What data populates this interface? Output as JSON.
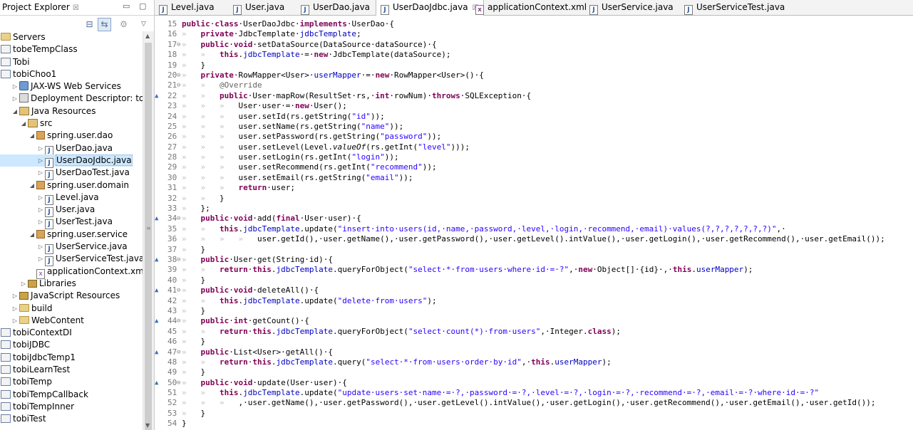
{
  "explorer": {
    "title": "Project Explorer",
    "items": [
      {
        "indent": 0,
        "arrow": "",
        "icon": "folder",
        "label": "Servers"
      },
      {
        "indent": 0,
        "arrow": "",
        "icon": "project",
        "label": "tobeTempClass"
      },
      {
        "indent": 0,
        "arrow": "",
        "icon": "project",
        "label": "Tobi"
      },
      {
        "indent": 0,
        "arrow": "",
        "icon": "project",
        "label": "tobiChoo1"
      },
      {
        "indent": 1,
        "arrow": "▷",
        "icon": "ws",
        "label": "JAX-WS Web Services"
      },
      {
        "indent": 1,
        "arrow": "▷",
        "icon": "dd",
        "label": "Deployment Descriptor: tobiCh"
      },
      {
        "indent": 1,
        "arrow": "◢",
        "icon": "res",
        "label": "Java Resources"
      },
      {
        "indent": 2,
        "arrow": "◢",
        "icon": "res",
        "label": "src"
      },
      {
        "indent": 3,
        "arrow": "◢",
        "icon": "package",
        "label": "spring.user.dao"
      },
      {
        "indent": 4,
        "arrow": "▷",
        "icon": "java",
        "label": "UserDao.java"
      },
      {
        "indent": 4,
        "arrow": "▷",
        "icon": "java",
        "label": "UserDaoJdbc.java",
        "selected": true
      },
      {
        "indent": 4,
        "arrow": "▷",
        "icon": "java",
        "label": "UserDaoTest.java"
      },
      {
        "indent": 3,
        "arrow": "◢",
        "icon": "package",
        "label": "spring.user.domain"
      },
      {
        "indent": 4,
        "arrow": "▷",
        "icon": "java",
        "label": "Level.java"
      },
      {
        "indent": 4,
        "arrow": "▷",
        "icon": "java",
        "label": "User.java"
      },
      {
        "indent": 4,
        "arrow": "▷",
        "icon": "java",
        "label": "UserTest.java"
      },
      {
        "indent": 3,
        "arrow": "◢",
        "icon": "package",
        "label": "spring.user.service"
      },
      {
        "indent": 4,
        "arrow": "▷",
        "icon": "java",
        "label": "UserService.java"
      },
      {
        "indent": 4,
        "arrow": "▷",
        "icon": "java",
        "label": "UserServiceTest.java"
      },
      {
        "indent": 3,
        "arrow": "",
        "icon": "xml",
        "label": "applicationContext.xml"
      },
      {
        "indent": 2,
        "arrow": "▷",
        "icon": "lib",
        "label": "Libraries"
      },
      {
        "indent": 1,
        "arrow": "▷",
        "icon": "lib",
        "label": "JavaScript Resources"
      },
      {
        "indent": 1,
        "arrow": "▷",
        "icon": "folder",
        "label": "build"
      },
      {
        "indent": 1,
        "arrow": "▷",
        "icon": "folder",
        "label": "WebContent"
      },
      {
        "indent": 0,
        "arrow": "",
        "icon": "project",
        "label": "tobiContextDI"
      },
      {
        "indent": 0,
        "arrow": "",
        "icon": "project",
        "label": "tobiJDBC"
      },
      {
        "indent": 0,
        "arrow": "",
        "icon": "project",
        "label": "tobiJdbcTemp1"
      },
      {
        "indent": 0,
        "arrow": "",
        "icon": "project",
        "label": "tobiLearnTest"
      },
      {
        "indent": 0,
        "arrow": "",
        "icon": "project",
        "label": "tobiTemp"
      },
      {
        "indent": 0,
        "arrow": "",
        "icon": "project",
        "label": "tobiTempCallback"
      },
      {
        "indent": 0,
        "arrow": "",
        "icon": "project",
        "label": "tobiTempInner"
      },
      {
        "indent": 0,
        "arrow": "",
        "icon": "project",
        "label": "tobiTest"
      }
    ]
  },
  "tabs": [
    {
      "label": "Level.java",
      "icon": "java"
    },
    {
      "label": "User.java",
      "icon": "java"
    },
    {
      "label": "UserDao.java",
      "icon": "java"
    },
    {
      "label": "UserDaoJdbc.java",
      "icon": "java",
      "active": true
    },
    {
      "label": "applicationContext.xml",
      "icon": "xml"
    },
    {
      "label": "UserService.java",
      "icon": "java"
    },
    {
      "label": "UserServiceTest.java",
      "icon": "java"
    }
  ],
  "code": [
    {
      "n": "15",
      "segs": [
        [
          "k",
          "public"
        ],
        [
          "",
          "·"
        ],
        [
          "k",
          "class"
        ],
        [
          "",
          "·UserDaoJdbc·"
        ],
        [
          "k",
          "implements"
        ],
        [
          "",
          "·UserDao·{"
        ]
      ]
    },
    {
      "n": "16",
      "segs": [
        [
          "ws",
          "»   "
        ],
        [
          "k",
          "private"
        ],
        [
          "",
          "·JdbcTemplate·"
        ],
        [
          "f",
          "jdbcTemplate"
        ],
        [
          "",
          ";"
        ]
      ]
    },
    {
      "n": "17",
      "mark": "⊖",
      "segs": [
        [
          "ws",
          "»   "
        ],
        [
          "k",
          "public"
        ],
        [
          "",
          "·"
        ],
        [
          "k",
          "void"
        ],
        [
          "",
          "·setDataSource(DataSource·dataSource)·{"
        ]
      ]
    },
    {
      "n": "18",
      "segs": [
        [
          "ws",
          "»   »   "
        ],
        [
          "k",
          "this"
        ],
        [
          "",
          "."
        ],
        [
          "f",
          "jdbcTemplate"
        ],
        [
          "",
          "·=·"
        ],
        [
          "k",
          "new"
        ],
        [
          "",
          "·JdbcTemplate(dataSource);"
        ]
      ]
    },
    {
      "n": "19",
      "segs": [
        [
          "ws",
          "»   "
        ],
        [
          "",
          "}"
        ]
      ]
    },
    {
      "n": "20",
      "mark": "⊖",
      "segs": [
        [
          "ws",
          "»   "
        ],
        [
          "k",
          "private"
        ],
        [
          "",
          "·RowMapper<User>·"
        ],
        [
          "f",
          "userMapper"
        ],
        [
          "",
          "·=·"
        ],
        [
          "k",
          "new"
        ],
        [
          "",
          "·RowMapper<User>()·{"
        ]
      ]
    },
    {
      "n": "21",
      "mark": "⊖",
      "segs": [
        [
          "ws",
          "»   »   "
        ],
        [
          "a",
          "@Override"
        ]
      ]
    },
    {
      "n": "22",
      "ovr": true,
      "segs": [
        [
          "ws",
          "»   »   "
        ],
        [
          "k",
          "public"
        ],
        [
          "",
          "·User·mapRow(ResultSet·rs,·"
        ],
        [
          "k",
          "int"
        ],
        [
          "",
          "·rowNum)·"
        ],
        [
          "k",
          "throws"
        ],
        [
          "",
          "·SQLException·{"
        ]
      ]
    },
    {
      "n": "23",
      "segs": [
        [
          "ws",
          "»   »   »   "
        ],
        [
          "",
          "User·user·=·"
        ],
        [
          "k",
          "new"
        ],
        [
          "",
          "·User();"
        ]
      ]
    },
    {
      "n": "24",
      "segs": [
        [
          "ws",
          "»   »   »   "
        ],
        [
          "",
          "user.setId(rs.getString("
        ],
        [
          "s",
          "\"id\""
        ],
        [
          "",
          "));"
        ]
      ]
    },
    {
      "n": "25",
      "segs": [
        [
          "ws",
          "»   »   »   "
        ],
        [
          "",
          "user.setName(rs.getString("
        ],
        [
          "s",
          "\"name\""
        ],
        [
          "",
          "));"
        ]
      ]
    },
    {
      "n": "26",
      "segs": [
        [
          "ws",
          "»   »   »   "
        ],
        [
          "",
          "user.setPassword(rs.getString("
        ],
        [
          "s",
          "\"password\""
        ],
        [
          "",
          "));"
        ]
      ]
    },
    {
      "n": "27",
      "segs": [
        [
          "ws",
          "»   »   »   "
        ],
        [
          "",
          "user.setLevel(Level."
        ],
        [
          "i",
          "valueOf"
        ],
        [
          "",
          "(rs.getInt("
        ],
        [
          "s",
          "\"level\""
        ],
        [
          "",
          ")));"
        ]
      ]
    },
    {
      "n": "28",
      "segs": [
        [
          "ws",
          "»   »   »   "
        ],
        [
          "",
          "user.setLogin(rs.getInt("
        ],
        [
          "s",
          "\"login\""
        ],
        [
          "",
          "));"
        ]
      ]
    },
    {
      "n": "29",
      "segs": [
        [
          "ws",
          "»   »   »   "
        ],
        [
          "",
          "user.setRecommend(rs.getInt("
        ],
        [
          "s",
          "\"recommend\""
        ],
        [
          "",
          "));"
        ]
      ]
    },
    {
      "n": "30",
      "segs": [
        [
          "ws",
          "»   »   »   "
        ],
        [
          "",
          "user.setEmail(rs.getString("
        ],
        [
          "s",
          "\"email\""
        ],
        [
          "",
          "));"
        ]
      ]
    },
    {
      "n": "31",
      "segs": [
        [
          "ws",
          "»   »   »   "
        ],
        [
          "k",
          "return"
        ],
        [
          "",
          "·user;"
        ]
      ]
    },
    {
      "n": "32",
      "segs": [
        [
          "ws",
          "»   »   "
        ],
        [
          "",
          "}"
        ]
      ]
    },
    {
      "n": "33",
      "segs": [
        [
          "ws",
          "»   "
        ],
        [
          "",
          "};"
        ]
      ]
    },
    {
      "n": "34",
      "mark": "⊖",
      "ovr": true,
      "segs": [
        [
          "ws",
          "»   "
        ],
        [
          "k",
          "public"
        ],
        [
          "",
          "·"
        ],
        [
          "k",
          "void"
        ],
        [
          "",
          "·add("
        ],
        [
          "k",
          "final"
        ],
        [
          "",
          "·User·user)·{"
        ]
      ]
    },
    {
      "n": "35",
      "segs": [
        [
          "ws",
          "»   »   "
        ],
        [
          "k",
          "this"
        ],
        [
          "",
          "."
        ],
        [
          "f",
          "jdbcTemplate"
        ],
        [
          "",
          ".update("
        ],
        [
          "s",
          "\"insert·into·users(id,·name,·password,·level,·login,·recommend,·email)·values(?,?,?,?,?,?,?)\""
        ],
        [
          "",
          ",·"
        ]
      ]
    },
    {
      "n": "36",
      "segs": [
        [
          "ws",
          "»   »   »   »   "
        ],
        [
          "",
          "user.getId(),·user.getName(),·user.getPassword(),·user.getLevel().intValue(),·user.getLogin(),·user.getRecommend(),·user.getEmail());"
        ]
      ]
    },
    {
      "n": "37",
      "segs": [
        [
          "ws",
          "»   "
        ],
        [
          "",
          "}"
        ]
      ]
    },
    {
      "n": "38",
      "mark": "⊖",
      "ovr": true,
      "segs": [
        [
          "ws",
          "»   "
        ],
        [
          "k",
          "public"
        ],
        [
          "",
          "·User·get(String·id)·{"
        ]
      ]
    },
    {
      "n": "39",
      "segs": [
        [
          "ws",
          "»   »   "
        ],
        [
          "k",
          "return"
        ],
        [
          "",
          "·"
        ],
        [
          "k",
          "this"
        ],
        [
          "",
          "."
        ],
        [
          "f",
          "jdbcTemplate"
        ],
        [
          "",
          ".queryForObject("
        ],
        [
          "s",
          "\"select·*·from·users·where·id·=·?\""
        ],
        [
          "",
          ",·"
        ],
        [
          "k",
          "new"
        ],
        [
          "",
          "·Object[]·{id}·,·"
        ],
        [
          "k",
          "this"
        ],
        [
          "",
          "."
        ],
        [
          "f",
          "userMapper"
        ],
        [
          "",
          ");"
        ]
      ]
    },
    {
      "n": "40",
      "segs": [
        [
          "ws",
          "»   "
        ],
        [
          "",
          "}"
        ]
      ]
    },
    {
      "n": "41",
      "mark": "⊖",
      "ovr": true,
      "segs": [
        [
          "ws",
          "»   "
        ],
        [
          "k",
          "public"
        ],
        [
          "",
          "·"
        ],
        [
          "k",
          "void"
        ],
        [
          "",
          "·deleteAll()·{"
        ]
      ]
    },
    {
      "n": "42",
      "segs": [
        [
          "ws",
          "»   »   "
        ],
        [
          "k",
          "this"
        ],
        [
          "",
          "."
        ],
        [
          "f",
          "jdbcTemplate"
        ],
        [
          "",
          ".update("
        ],
        [
          "s",
          "\"delete·from·users\""
        ],
        [
          "",
          ");"
        ]
      ]
    },
    {
      "n": "43",
      "segs": [
        [
          "ws",
          "»   "
        ],
        [
          "",
          "}"
        ]
      ]
    },
    {
      "n": "44",
      "mark": "⊖",
      "ovr": true,
      "segs": [
        [
          "ws",
          "»   "
        ],
        [
          "k",
          "public"
        ],
        [
          "",
          "·"
        ],
        [
          "k",
          "int"
        ],
        [
          "",
          "·getCount()·{"
        ]
      ]
    },
    {
      "n": "45",
      "segs": [
        [
          "ws",
          "»   »   "
        ],
        [
          "k",
          "return"
        ],
        [
          "",
          "·"
        ],
        [
          "k",
          "this"
        ],
        [
          "",
          "."
        ],
        [
          "f",
          "jdbcTemplate"
        ],
        [
          "",
          ".queryForObject("
        ],
        [
          "s",
          "\"select·count(*)·from·users\""
        ],
        [
          "",
          ",·Integer."
        ],
        [
          "k",
          "class"
        ],
        [
          "",
          ");"
        ]
      ]
    },
    {
      "n": "46",
      "segs": [
        [
          "ws",
          "»   "
        ],
        [
          "",
          "}"
        ]
      ]
    },
    {
      "n": "47",
      "mark": "⊖",
      "ovr": true,
      "segs": [
        [
          "ws",
          "»   "
        ],
        [
          "k",
          "public"
        ],
        [
          "",
          "·List<User>·getAll()·{"
        ]
      ]
    },
    {
      "n": "48",
      "segs": [
        [
          "ws",
          "»   »   "
        ],
        [
          "k",
          "return"
        ],
        [
          "",
          "·"
        ],
        [
          "k",
          "this"
        ],
        [
          "",
          "."
        ],
        [
          "f",
          "jdbcTemplate"
        ],
        [
          "",
          ".query("
        ],
        [
          "s",
          "\"select·*·from·users·order·by·id\""
        ],
        [
          "",
          ",·"
        ],
        [
          "k",
          "this"
        ],
        [
          "",
          "."
        ],
        [
          "f",
          "userMapper"
        ],
        [
          "",
          ");"
        ]
      ]
    },
    {
      "n": "49",
      "segs": [
        [
          "ws",
          "»   "
        ],
        [
          "",
          "}"
        ]
      ]
    },
    {
      "n": "50",
      "mark": "⊖",
      "ovr": true,
      "segs": [
        [
          "ws",
          "»   "
        ],
        [
          "k",
          "public"
        ],
        [
          "",
          "·"
        ],
        [
          "k",
          "void"
        ],
        [
          "",
          "·update(User·user)·{"
        ]
      ]
    },
    {
      "n": "51",
      "segs": [
        [
          "ws",
          "»   »   "
        ],
        [
          "k",
          "this"
        ],
        [
          "",
          "."
        ],
        [
          "f",
          "jdbcTemplate"
        ],
        [
          "",
          ".update("
        ],
        [
          "s",
          "\"update·users·set·name·=·?,·password·=·?,·level·=·?,·login·=·?,·recommend·=·?,·email·=·?·where·id·=·?\""
        ]
      ]
    },
    {
      "n": "52",
      "segs": [
        [
          "ws",
          "»   »   »   "
        ],
        [
          "",
          ",·user.getName(),·user.getPassword(),·user.getLevel().intValue(),·user.getLogin(),·user.getRecommend(),·user.getEmail(),·user.getId());"
        ]
      ]
    },
    {
      "n": "53",
      "segs": [
        [
          "ws",
          "»   "
        ],
        [
          "",
          "}"
        ]
      ]
    },
    {
      "n": "54",
      "segs": [
        [
          "",
          "}"
        ]
      ]
    }
  ]
}
